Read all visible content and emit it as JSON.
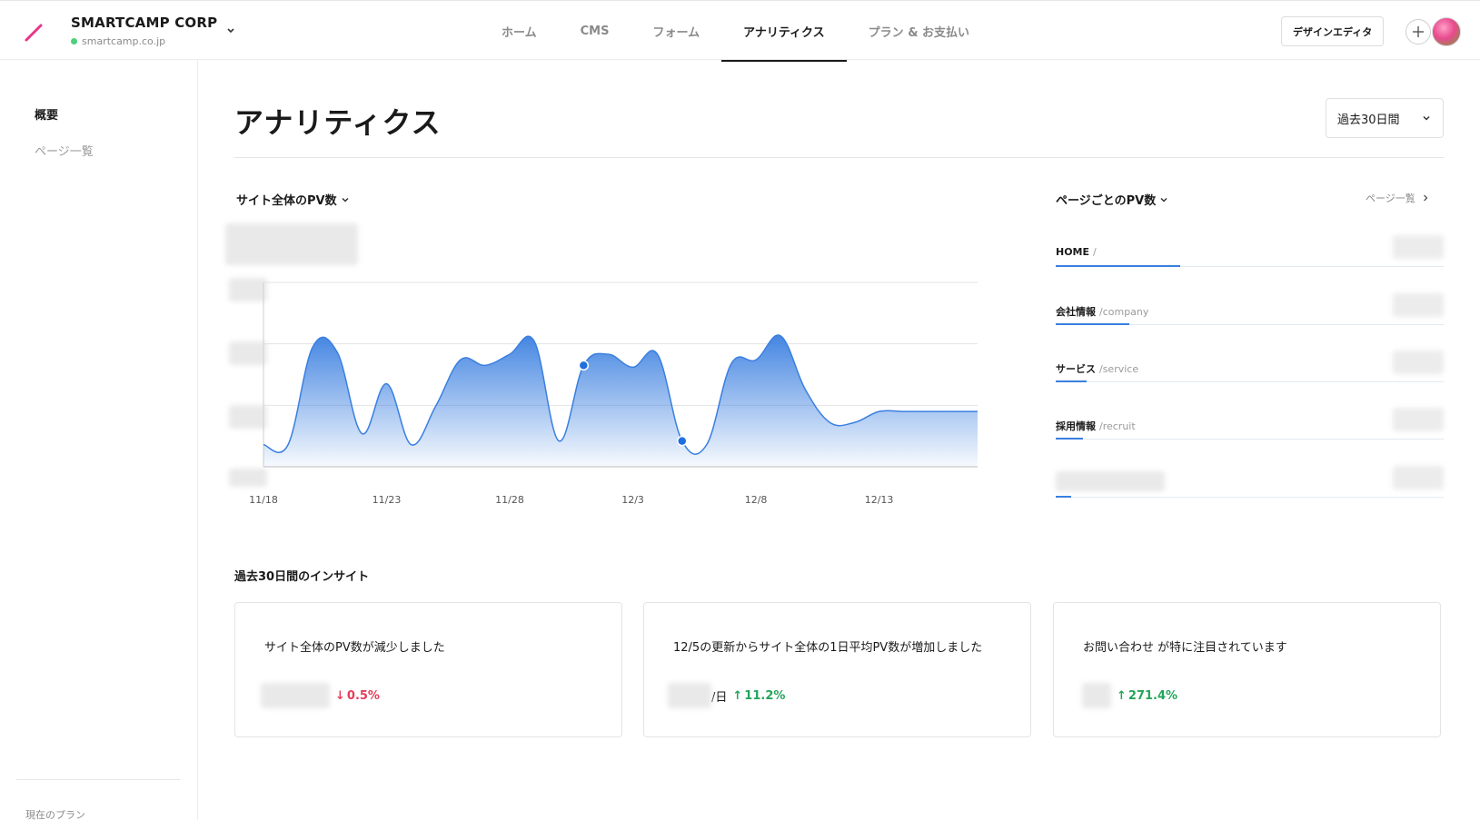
{
  "brand": {
    "name": "SMARTCAMP CORP",
    "domain": "smartcamp.co.jp",
    "status_color": "#4cd07a"
  },
  "nav": {
    "items": [
      "ホーム",
      "CMS",
      "フォーム",
      "アナリティクス",
      "プラン & お支払い"
    ],
    "active": "アナリティクス"
  },
  "toolbar": {
    "design_editor_label": "デザインエディタ"
  },
  "sidebar": {
    "items": [
      {
        "label": "概要",
        "active": true
      },
      {
        "label": "ページ一覧",
        "active": false
      }
    ],
    "plan_label": "現在のプラン"
  },
  "main": {
    "title": "アナリティクス",
    "period_label": "過去30日間"
  },
  "pv_section": {
    "title": "サイト全体のPV数"
  },
  "chart_data": {
    "type": "area",
    "x": [
      "11/18",
      "11/19",
      "11/20",
      "11/21",
      "11/22",
      "11/23",
      "11/24",
      "11/25",
      "11/26",
      "11/27",
      "11/28",
      "11/29",
      "11/30",
      "12/1",
      "12/2",
      "12/3",
      "12/4",
      "12/5",
      "12/6",
      "12/7",
      "12/8",
      "12/9",
      "12/10",
      "12/11",
      "12/12",
      "12/13",
      "12/14",
      "12/15",
      "12/16",
      "12/17"
    ],
    "values": [
      0.12,
      0.12,
      0.65,
      0.62,
      0.18,
      0.45,
      0.12,
      0.33,
      0.58,
      0.55,
      0.61,
      0.68,
      0.14,
      0.55,
      0.61,
      0.54,
      0.61,
      0.14,
      0.12,
      0.56,
      0.58,
      0.71,
      0.42,
      0.24,
      0.24,
      0.3,
      0.3,
      0.3,
      0.3,
      0.3
    ],
    "tick_labels": [
      "11/18",
      "11/23",
      "11/28",
      "12/3",
      "12/8",
      "12/13"
    ],
    "highlighted": [
      "12/1",
      "12/5"
    ],
    "ylim": [
      0,
      1
    ],
    "grid": true,
    "color": "#3a7fe0"
  },
  "pages_section": {
    "title": "ページごとのPV数",
    "link_label": "ページ一覧",
    "rows": [
      {
        "name": "HOME",
        "path": "/",
        "share": 0.32
      },
      {
        "name": "会社情報",
        "path": "/company",
        "share": 0.19
      },
      {
        "name": "サービス",
        "path": "/service",
        "share": 0.08
      },
      {
        "name": "採用情報",
        "path": "/recruit",
        "share": 0.07
      },
      {
        "name": "",
        "path": "",
        "share": 0.04
      }
    ]
  },
  "insights": {
    "title": "過去30日間のインサイト",
    "cards": [
      {
        "message": "サイト全体のPV数が減少しました",
        "direction": "down",
        "arrow": "↓",
        "change": "0.5%",
        "unit": ""
      },
      {
        "message": "12/5の更新からサイト全体の1日平均PV数が増加しました",
        "direction": "up",
        "arrow": "↑",
        "change": "11.2%",
        "unit": "/日"
      },
      {
        "message": "お問い合わせ が特に注目されています",
        "direction": "up",
        "arrow": "↑",
        "change": "271.4%",
        "unit": ""
      }
    ]
  }
}
